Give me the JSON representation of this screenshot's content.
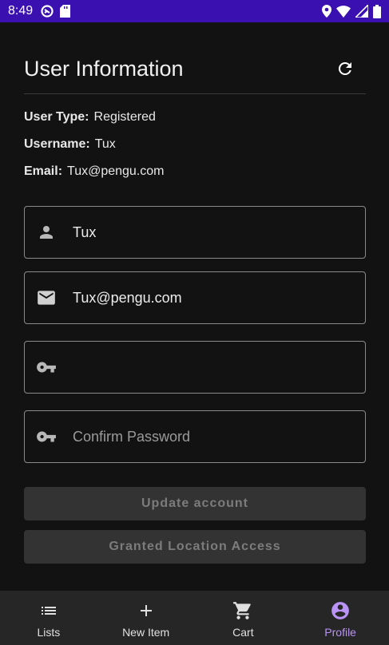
{
  "status_bar": {
    "time": "8:49"
  },
  "header": {
    "title": "User Information"
  },
  "user_info": {
    "user_type_label": "User Type:",
    "user_type_value": "Registered",
    "username_label": "Username:",
    "username_value": "Tux",
    "email_label": "Email:",
    "email_value": "Tux@pengu.com"
  },
  "form": {
    "username_value": "Tux",
    "email_value": "Tux@pengu.com",
    "password_value": "",
    "password_placeholder": "",
    "confirm_password_placeholder": "Confirm Password"
  },
  "buttons": {
    "update_account": "Update account",
    "location_access": "Granted Location Access"
  },
  "bottom_nav": {
    "items": [
      {
        "label": "Lists",
        "icon": "list-icon"
      },
      {
        "label": "New Item",
        "icon": "plus-icon"
      },
      {
        "label": "Cart",
        "icon": "cart-icon"
      },
      {
        "label": "Profile",
        "icon": "account-circle-icon",
        "active": true
      }
    ]
  },
  "colors": {
    "status_bar": "#3b10b0",
    "background": "#121212",
    "accent": "#b993f5",
    "nav_background": "#262626",
    "disabled_button": "#333333"
  }
}
